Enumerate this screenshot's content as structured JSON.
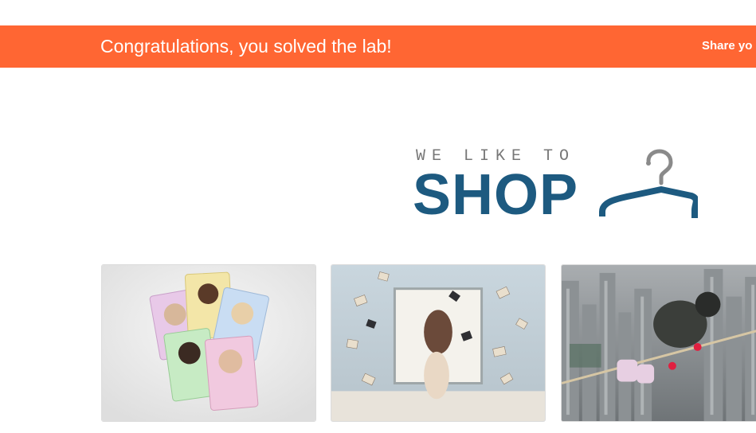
{
  "banner": {
    "title": "Congratulations, you solved the lab!",
    "share_label": "Share yo",
    "background_color": "#ff6633"
  },
  "logo": {
    "tagline": "WE LIKE TO",
    "wordmark": "SHOP",
    "icon": "hanger-icon",
    "wordmark_color": "#1d5a80"
  },
  "products": [
    {
      "image": "celebrity-trump-cards"
    },
    {
      "image": "floating-books-bedroom"
    },
    {
      "image": "child-tightrope-city"
    }
  ]
}
